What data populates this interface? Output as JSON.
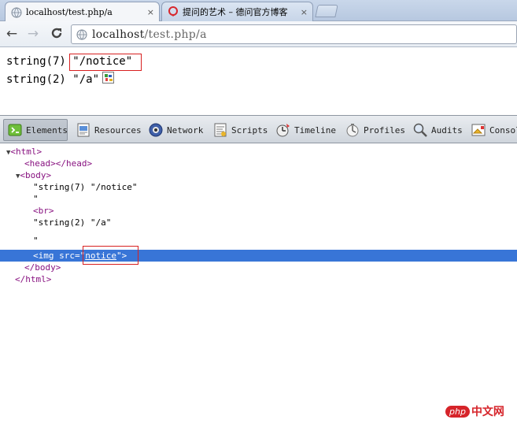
{
  "tabs": [
    {
      "title": "localhost/test.php/a",
      "close": "×"
    },
    {
      "title": "提问的艺术 – 德问官方博客",
      "close": "×"
    }
  ],
  "toolbar": {
    "back": "←",
    "forward": "→",
    "reload": "C",
    "url_host": "localhost",
    "url_path": "/test.php/a"
  },
  "page": {
    "line1_prefix": "string(7) ",
    "line1_value": "\"/notice\"",
    "line2": "string(2) \"/a\""
  },
  "devtools": {
    "tabs": [
      "Elements",
      "Resources",
      "Network",
      "Scripts",
      "Timeline",
      "Profiles",
      "Audits",
      "Console"
    ],
    "dom": {
      "html_open": "<html>",
      "head": "<head></head>",
      "body_open": "<body>",
      "text1": "\"string(7) \"/notice\"",
      "text1_end": "\"",
      "br": "<br>",
      "text2": "\"string(2) \"/a\"",
      "text2_end": "\"",
      "img_open": "<img ",
      "img_attr": "src",
      "img_eq": "=\"",
      "img_val": "notice",
      "img_close": "\">",
      "body_close": "</body>",
      "html_close": "</html>"
    }
  },
  "watermark": {
    "php": "php",
    "cn": "中文网"
  }
}
